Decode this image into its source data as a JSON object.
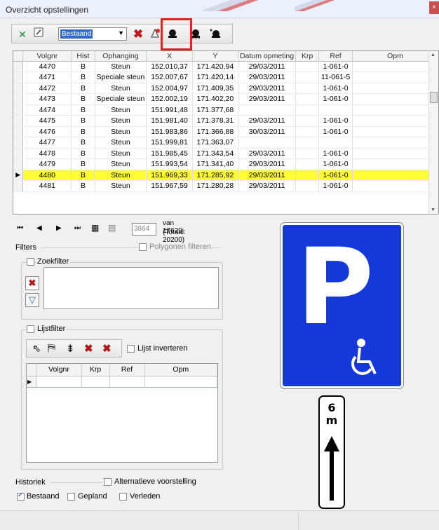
{
  "window": {
    "title": "Overzicht opstellingen",
    "close": "×"
  },
  "toolbar": {
    "dropdown_value": "Bestaand",
    "icons": [
      "export-excel-icon",
      "edit-icon",
      "dropdown-arrow-icon",
      "delete-icon",
      "map-pin-icon",
      "sign-pole-icon",
      "sign-pole-down-icon",
      "sign-pole-up-icon"
    ]
  },
  "grid": {
    "columns": [
      "Volgnr",
      "Hist",
      "Ophanging",
      "X",
      "Y",
      "Datum opmeting",
      "Krp",
      "Ref",
      "Opm"
    ],
    "rows": [
      [
        "4470",
        "B",
        "Steun",
        "152.010,37",
        "171.420,94",
        "29/03/2011",
        "",
        "1-061-0",
        ""
      ],
      [
        "4471",
        "B",
        "Speciale steun",
        "152.007,67",
        "171.420,14",
        "29/03/2011",
        "",
        "11-061-5",
        ""
      ],
      [
        "4472",
        "B",
        "Steun",
        "152.004,97",
        "171.409,35",
        "29/03/2011",
        "",
        "1-061-0",
        ""
      ],
      [
        "4473",
        "B",
        "Speciale steun",
        "152.002,19",
        "171.402,20",
        "29/03/2011",
        "",
        "1-061-0",
        ""
      ],
      [
        "4474",
        "B",
        "Steun",
        "151.991,48",
        "171.377,68",
        "",
        "",
        "",
        ""
      ],
      [
        "4475",
        "B",
        "Steun",
        "151.981,40",
        "171.378,31",
        "29/03/2011",
        "",
        "1-061-0",
        ""
      ],
      [
        "4476",
        "B",
        "Steun",
        "151.983,86",
        "171.366,88",
        "30/03/2011",
        "",
        "1-061-0",
        ""
      ],
      [
        "4477",
        "B",
        "Steun",
        "151.999,81",
        "171.363,07",
        "",
        "",
        "",
        ""
      ],
      [
        "4478",
        "B",
        "Steun",
        "151.985,45",
        "171.343,54",
        "29/03/2011",
        "",
        "1-061-0",
        ""
      ],
      [
        "4479",
        "B",
        "Steun",
        "151.993,54",
        "171.341,40",
        "29/03/2011",
        "",
        "1-061-0",
        ""
      ],
      [
        "4480",
        "B",
        "Steun",
        "151.969,33",
        "171.285,92",
        "29/03/2011",
        "",
        "1-061-0",
        ""
      ],
      [
        "4481",
        "B",
        "Steun",
        "151.967,59",
        "171.280,28",
        "29/03/2011",
        "",
        "1-061-0",
        ""
      ]
    ],
    "selected_row": 10
  },
  "navigator": {
    "page_value": "3864",
    "of_label": "van 17620",
    "total_label": "(Totaal: 20200)"
  },
  "filters": {
    "group_label": "Filters",
    "polygon_filter_label": "Polygonen filteren",
    "search_filter_label": "Zoekfilter",
    "list_filter_label": "Lijstfilter",
    "invert_list_label": "Lijst inverteren",
    "list_columns": [
      "Volgnr",
      "Krp",
      "Ref",
      "Opm"
    ]
  },
  "history": {
    "group_label": "Historiek",
    "alt_view_label": "Alternatieve voorstelling",
    "existing_label": "Bestaand",
    "planned_label": "Gepland",
    "past_label": "Verleden",
    "existing_checked": true
  },
  "sign": {
    "main_letter": "P",
    "sub_value": "6",
    "sub_unit": "m",
    "colors": {
      "blue": "#1538d8",
      "white": "#ffffff"
    }
  },
  "colors": {
    "selection": "#ffff33",
    "highlight_box": "#e3211e"
  }
}
